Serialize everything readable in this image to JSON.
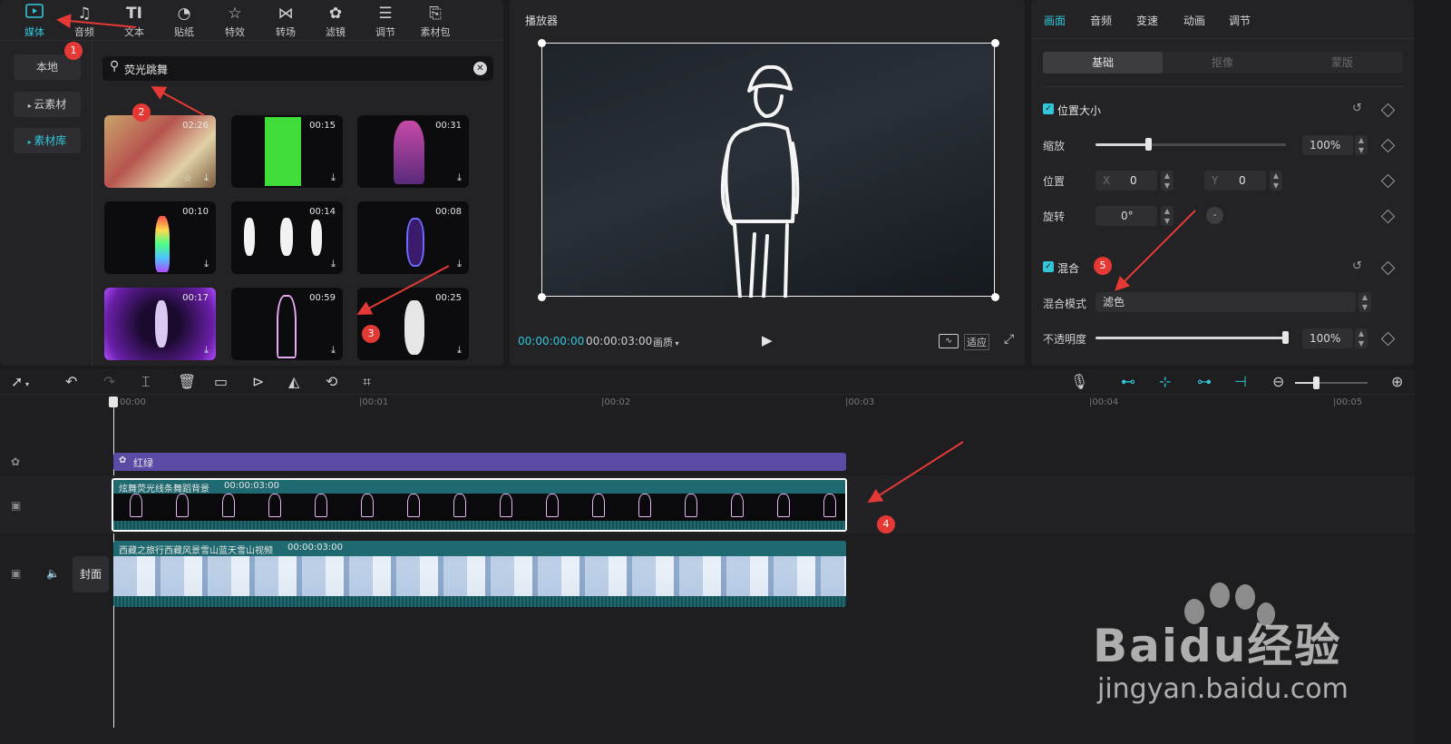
{
  "media_tools": [
    {
      "label": "媒体",
      "icon": "media-icon",
      "active": true
    },
    {
      "label": "音频",
      "icon": "audio-icon"
    },
    {
      "label": "文本",
      "icon": "text-icon"
    },
    {
      "label": "贴纸",
      "icon": "sticker-icon"
    },
    {
      "label": "特效",
      "icon": "effects-icon"
    },
    {
      "label": "转场",
      "icon": "transition-icon"
    },
    {
      "label": "滤镜",
      "icon": "filter-icon"
    },
    {
      "label": "调节",
      "icon": "adjust-icon"
    },
    {
      "label": "素材包",
      "icon": "package-icon"
    }
  ],
  "sidebar": {
    "items": [
      "本地",
      "云素材",
      "素材库"
    ]
  },
  "search": {
    "value": "荧光跳舞"
  },
  "thumbnails": [
    {
      "duration": "02:26"
    },
    {
      "duration": "00:15"
    },
    {
      "duration": "00:31"
    },
    {
      "duration": "00:10"
    },
    {
      "duration": "00:14"
    },
    {
      "duration": "00:08"
    },
    {
      "duration": "00:17"
    },
    {
      "duration": "00:59"
    },
    {
      "duration": "00:25"
    }
  ],
  "player": {
    "title": "播放器",
    "current_time": "00:00:00:00",
    "total_time": "00:00:03:00",
    "quality": "画质",
    "fit_label": "适应"
  },
  "props": {
    "tabs": [
      "画面",
      "音频",
      "变速",
      "动画",
      "调节"
    ],
    "subtabs": [
      "基础",
      "抠像",
      "蒙版"
    ],
    "section_position": "位置大小",
    "scale_label": "缩放",
    "scale_value": "100%",
    "position_label": "位置",
    "x_label": "X",
    "x_value": "0",
    "y_label": "Y",
    "y_value": "0",
    "rotate_label": "旋转",
    "rotate_value": "0°",
    "section_blend": "混合",
    "blend_mode_label": "混合模式",
    "blend_mode_value": "滤色",
    "opacity_label": "不透明度",
    "opacity_value": "100%",
    "scale_fraction": 0.28,
    "opacity_fraction": 1.0
  },
  "ruler": [
    "00:00",
    "|00:01",
    "|00:02",
    "|00:03",
    "|00:04",
    "|00:05"
  ],
  "tracks": {
    "filter_clip": "红绿",
    "overlay_clip_title": "炫舞荧光线条舞蹈背景",
    "overlay_clip_duration": "00:00:03:00",
    "main_clip_title": "西藏之旅行西藏风景雪山蓝天雪山视频",
    "main_clip_duration": "00:00:03:00",
    "cover_label": "封面"
  },
  "annotations": [
    "1",
    "2",
    "3",
    "4",
    "5"
  ],
  "watermark": {
    "brand": "Baidu经验",
    "url": "jingyan.baidu.com"
  },
  "colors": {
    "accent": "#33c6d8",
    "annotation": "#e53935",
    "filter_track": "#5b4aa6",
    "clip_header": "#1f6a70"
  }
}
